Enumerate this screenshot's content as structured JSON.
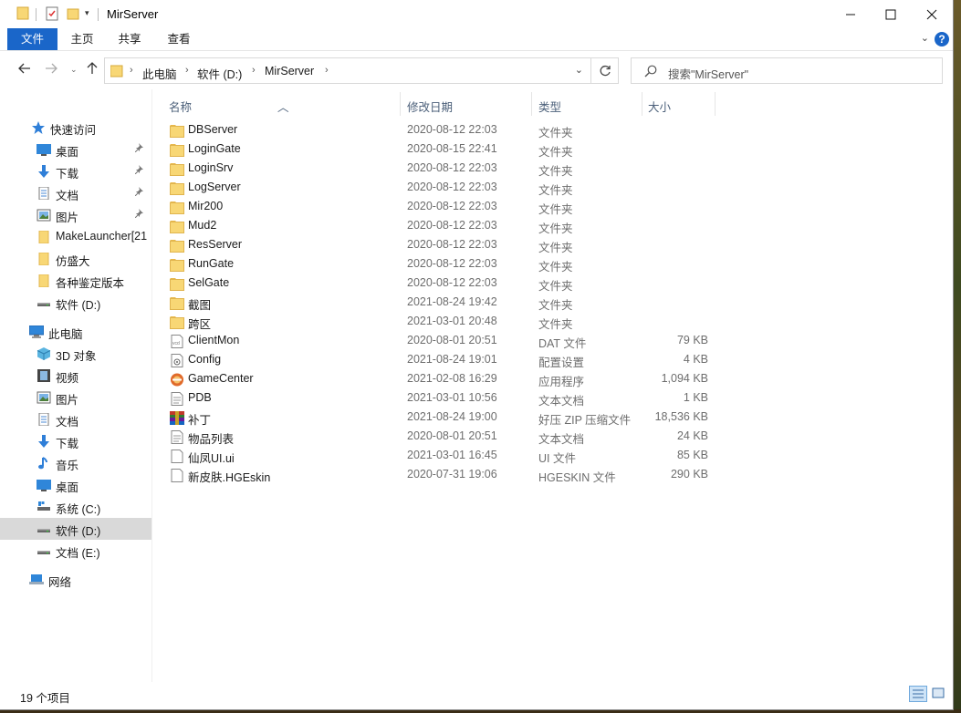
{
  "window": {
    "title": "MirServer"
  },
  "ribbon": {
    "tabs": [
      "文件",
      "主页",
      "共享",
      "查看"
    ],
    "help": "?"
  },
  "address": {
    "crumbs": [
      "此电脑",
      "软件 (D:)",
      "MirServer"
    ]
  },
  "search": {
    "placeholder": "搜索\"MirServer\""
  },
  "sidebar": {
    "items": [
      {
        "label": "快速访问",
        "icon": "star-icon"
      },
      {
        "label": "桌面",
        "icon": "desktop-icon",
        "pinned": true
      },
      {
        "label": "下载",
        "icon": "download-arrow-icon",
        "pinned": true
      },
      {
        "label": "文档",
        "icon": "document-icon",
        "pinned": true
      },
      {
        "label": "图片",
        "icon": "pictures-icon",
        "pinned": true
      },
      {
        "label": "MakeLauncher[21",
        "icon": "folder-icon"
      },
      {
        "label": "仿盛大",
        "icon": "folder-icon"
      },
      {
        "label": "各种鉴定版本",
        "icon": "folder-icon"
      },
      {
        "label": "软件 (D:)",
        "icon": "drive-icon"
      },
      {
        "label": "此电脑",
        "icon": "computer-icon"
      },
      {
        "label": "3D 对象",
        "icon": "3d-objects-icon"
      },
      {
        "label": "视频",
        "icon": "video-icon"
      },
      {
        "label": "图片",
        "icon": "pictures-icon"
      },
      {
        "label": "文档",
        "icon": "document-icon"
      },
      {
        "label": "下载",
        "icon": "download-arrow-icon"
      },
      {
        "label": "音乐",
        "icon": "music-icon"
      },
      {
        "label": "桌面",
        "icon": "desktop-icon"
      },
      {
        "label": "系统 (C:)",
        "icon": "system-drive-icon"
      },
      {
        "label": "软件 (D:)",
        "icon": "drive-icon",
        "selected": true
      },
      {
        "label": "文档 (E:)",
        "icon": "drive-icon"
      },
      {
        "label": "网络",
        "icon": "network-icon"
      }
    ]
  },
  "columns": {
    "name": "名称",
    "date": "修改日期",
    "type": "类型",
    "size": "大小"
  },
  "files": [
    {
      "name": "DBServer",
      "date": "2020-08-12 22:03",
      "type": "文件夹",
      "size": "",
      "icon": "folder-icon"
    },
    {
      "name": "LoginGate",
      "date": "2020-08-15 22:41",
      "type": "文件夹",
      "size": "",
      "icon": "folder-icon"
    },
    {
      "name": "LoginSrv",
      "date": "2020-08-12 22:03",
      "type": "文件夹",
      "size": "",
      "icon": "folder-icon"
    },
    {
      "name": "LogServer",
      "date": "2020-08-12 22:03",
      "type": "文件夹",
      "size": "",
      "icon": "folder-icon"
    },
    {
      "name": "Mir200",
      "date": "2020-08-12 22:03",
      "type": "文件夹",
      "size": "",
      "icon": "folder-icon"
    },
    {
      "name": "Mud2",
      "date": "2020-08-12 22:03",
      "type": "文件夹",
      "size": "",
      "icon": "folder-icon"
    },
    {
      "name": "ResServer",
      "date": "2020-08-12 22:03",
      "type": "文件夹",
      "size": "",
      "icon": "folder-icon"
    },
    {
      "name": "RunGate",
      "date": "2020-08-12 22:03",
      "type": "文件夹",
      "size": "",
      "icon": "folder-icon"
    },
    {
      "name": "SelGate",
      "date": "2020-08-12 22:03",
      "type": "文件夹",
      "size": "",
      "icon": "folder-icon"
    },
    {
      "name": "截图",
      "date": "2021-08-24 19:42",
      "type": "文件夹",
      "size": "",
      "icon": "folder-icon"
    },
    {
      "name": "跨区",
      "date": "2021-03-01 20:48",
      "type": "文件夹",
      "size": "",
      "icon": "folder-icon"
    },
    {
      "name": "ClientMon",
      "date": "2020-08-01 20:51",
      "type": "DAT 文件",
      "size": "79 KB",
      "icon": "dat-file-icon"
    },
    {
      "name": "Config",
      "date": "2021-08-24 19:01",
      "type": "配置设置",
      "size": "4 KB",
      "icon": "config-file-icon"
    },
    {
      "name": "GameCenter",
      "date": "2021-02-08 16:29",
      "type": "应用程序",
      "size": "1,094 KB",
      "icon": "app-icon"
    },
    {
      "name": "PDB",
      "date": "2021-03-01 10:56",
      "type": "文本文档",
      "size": "1 KB",
      "icon": "text-file-icon"
    },
    {
      "name": "补丁",
      "date": "2021-08-24 19:00",
      "type": "好压 ZIP 压缩文件",
      "size": "18,536 KB",
      "icon": "zip-archive-icon"
    },
    {
      "name": "物品列表",
      "date": "2020-08-01 20:51",
      "type": "文本文档",
      "size": "24 KB",
      "icon": "text-file-icon"
    },
    {
      "name": "仙凤UI.ui",
      "date": "2021-03-01 16:45",
      "type": "UI 文件",
      "size": "85 KB",
      "icon": "generic-file-icon"
    },
    {
      "name": "新皮肤.HGEskin",
      "date": "2020-07-31 19:06",
      "type": "HGESKIN 文件",
      "size": "290 KB",
      "icon": "generic-file-icon"
    }
  ],
  "status": {
    "count": "19 个项目"
  },
  "colors": {
    "accent": "#1a66c9",
    "selected": "#d9d9d9",
    "folder": "#f8d775"
  }
}
